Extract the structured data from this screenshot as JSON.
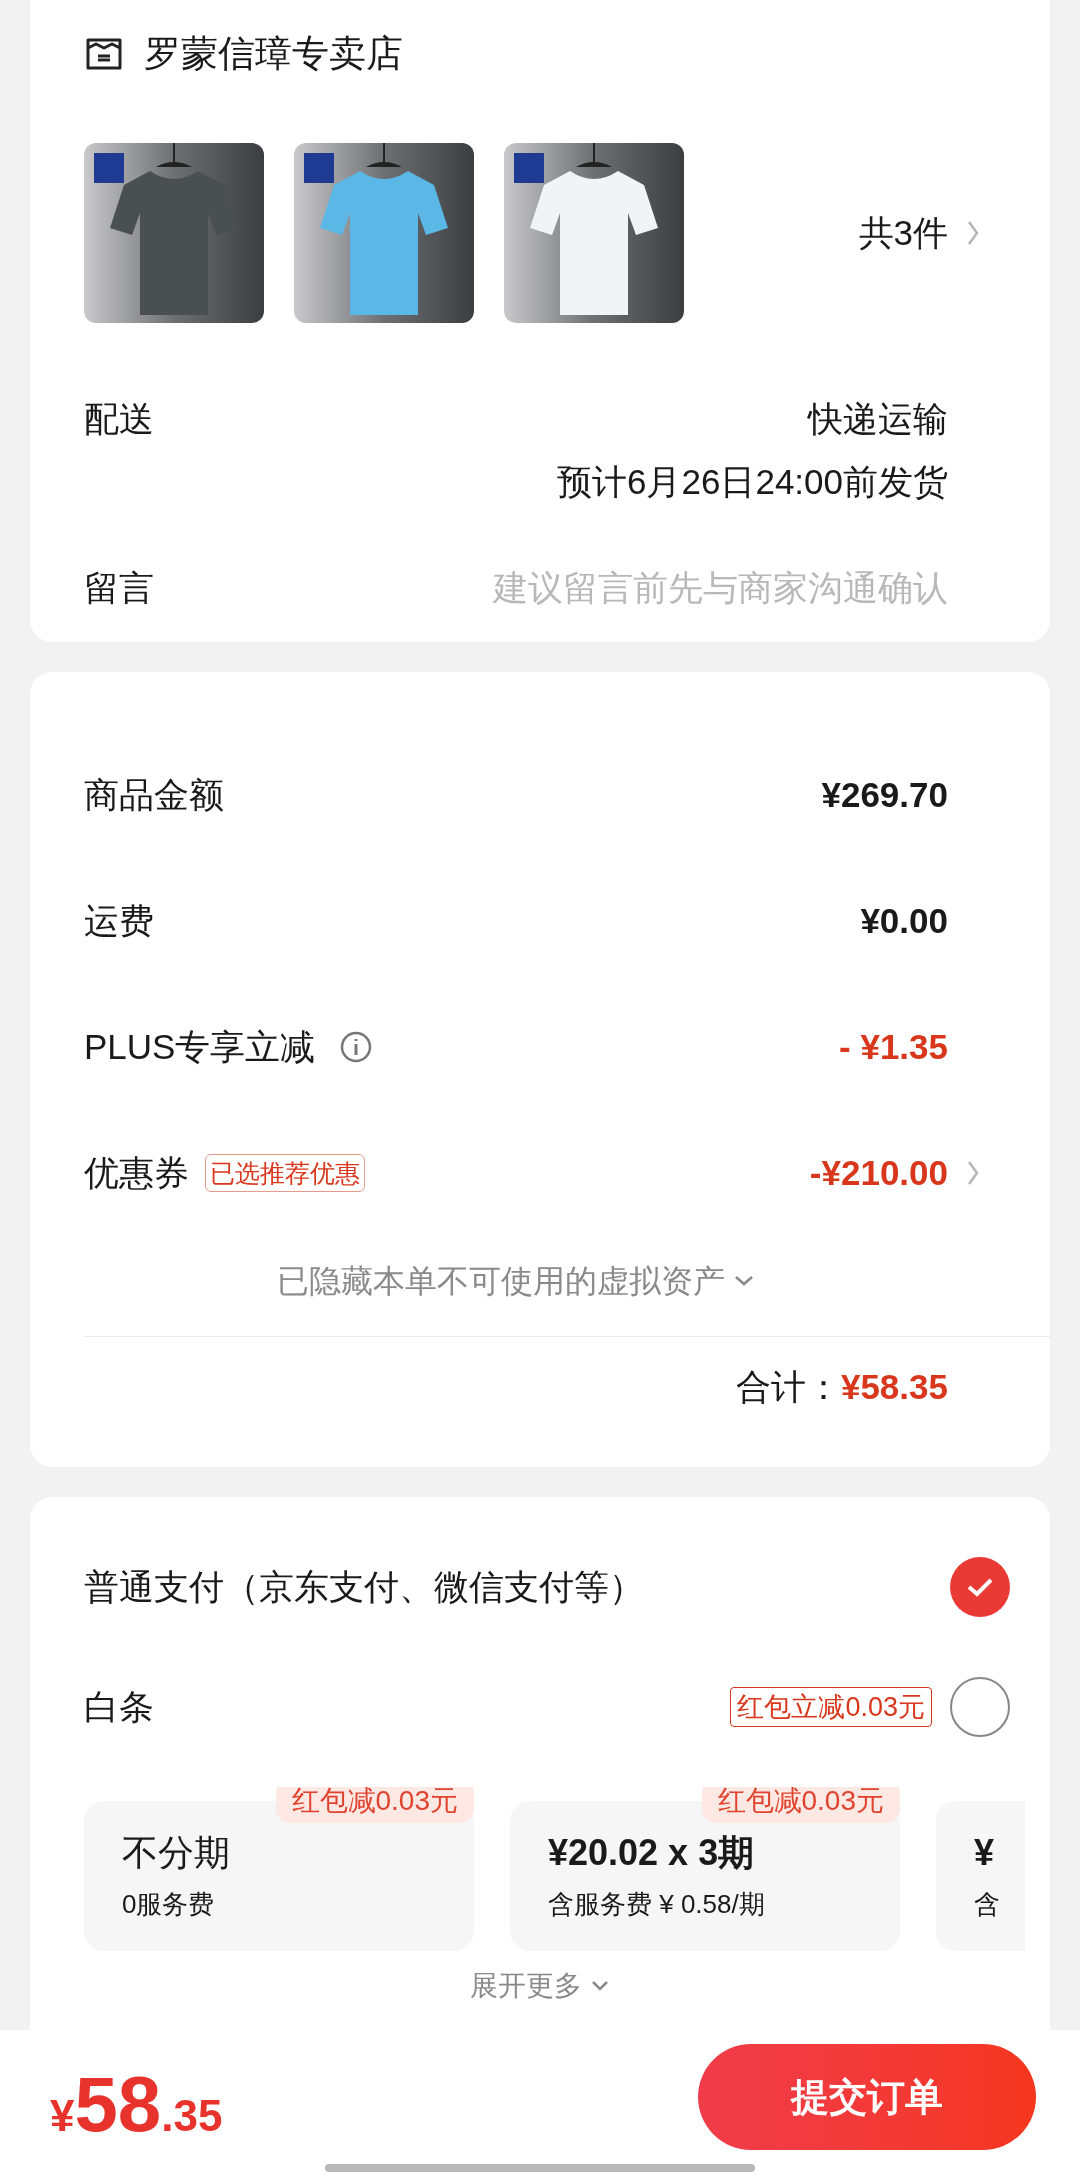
{
  "store": {
    "name": "罗蒙信璋专卖店"
  },
  "item_count": "共3件",
  "delivery": {
    "label": "配送",
    "method": "快递运输",
    "estimate": "预计6月26日24:00前发货"
  },
  "message": {
    "label": "留言",
    "placeholder": "建议留言前先与商家沟通确认"
  },
  "amounts": [
    {
      "label": "商品金额",
      "value": "¥269.70",
      "kind": "plain"
    },
    {
      "label": "运费",
      "value": "¥0.00",
      "kind": "plain"
    },
    {
      "label": "PLUS专享立减",
      "value": "- ¥1.35",
      "kind": "info"
    },
    {
      "label": "优惠券",
      "tag": "已选推荐优惠",
      "value": "-¥210.00",
      "kind": "coupon"
    }
  ],
  "hidden_assets": "已隐藏本单不可使用的虚拟资产",
  "total": {
    "label": "合计：",
    "value": "¥58.35"
  },
  "payments": [
    {
      "label": "普通支付（京东支付、微信支付等）",
      "selected": true
    },
    {
      "label": "白条",
      "tag": "红包立减0.03元",
      "selected": false
    }
  ],
  "installments": [
    {
      "badge": "红包减0.03元",
      "title": "不分期",
      "note": "0服务费"
    },
    {
      "badge": "红包减0.03元",
      "title": "¥20.02 x 3期",
      "note": "含服务费 ¥ 0.58/期"
    },
    {
      "title": "¥",
      "note": "含"
    }
  ],
  "expand_more": "展开更多",
  "footer": {
    "currency": "¥",
    "integer": "58",
    "decimal": ".35",
    "submit": "提交订单"
  }
}
